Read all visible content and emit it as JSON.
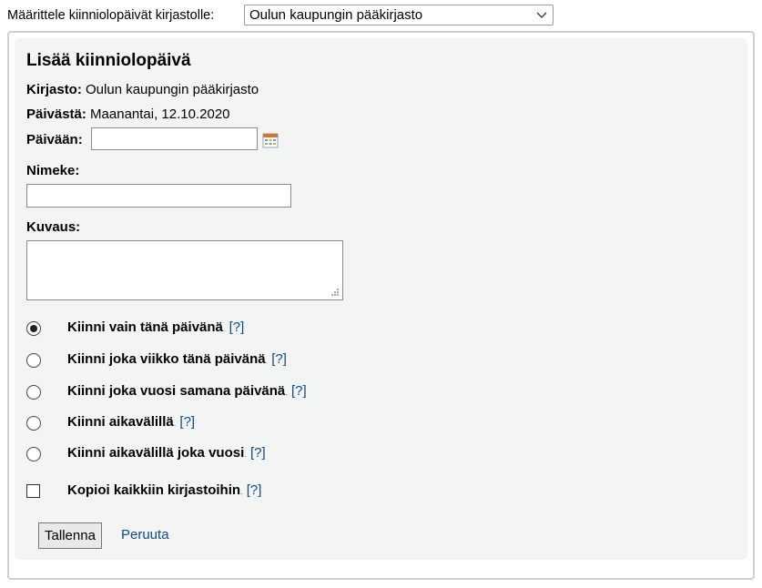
{
  "header": {
    "label": "Määrittele kiinniolopäivät kirjastolle:",
    "library_select_value": "Oulun kaupungin pääkirjasto"
  },
  "form": {
    "title": "Lisää kiinniolopäivä",
    "library_label": "Kirjasto:",
    "library_value": "Oulun kaupungin pääkirjasto",
    "from_label": "Päivästä:",
    "from_value": "Maanantai, 12.10.2020",
    "to_label": "Päivään:",
    "to_value": "",
    "title_label": "Nimeke:",
    "title_value": "",
    "description_label": "Kuvaus:",
    "description_value": "",
    "options": [
      {
        "label": "Kiinni vain tänä päivänä",
        "checked": true
      },
      {
        "label": "Kiinni joka viikko tänä päivänä",
        "checked": false
      },
      {
        "label": "Kiinni joka vuosi samana päivänä",
        "checked": false
      },
      {
        "label": "Kiinni aikavälillä",
        "checked": false
      },
      {
        "label": "Kiinni aikavälillä joka vuosi",
        "checked": false
      }
    ],
    "copy_all_label": "Kopioi kaikkiin kirjastoihin",
    "copy_all_checked": false,
    "help_text": "[?]",
    "dot_text": ".",
    "save_label": "Tallenna",
    "cancel_label": "Peruuta"
  },
  "icons": {
    "calendar": "calendar-icon",
    "dropdown": "chevron-down-icon",
    "resize": "resize-grip-icon"
  },
  "colors": {
    "panel_background": "#f3f5f5",
    "link": "#0c4b85",
    "border": "#cfcfcf"
  }
}
